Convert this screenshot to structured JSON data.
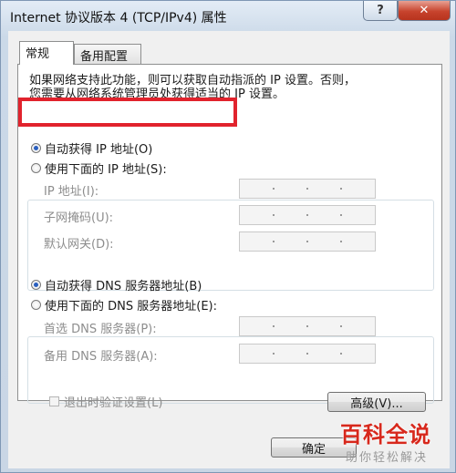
{
  "window": {
    "title": "Internet 协议版本 4 (TCP/IPv4) 属性",
    "help_label": "?",
    "close_label": "✕"
  },
  "tabs": [
    {
      "label": "常规",
      "selected": true
    },
    {
      "label": "备用配置",
      "selected": false
    }
  ],
  "general": {
    "description_line1": "如果网络支持此功能，则可以获取自动指派的 IP 设置。否则，",
    "description_line2": "您需要从网络系统管理员处获得适当的 IP 设置。",
    "ip_auto_label": "自动获得 IP 地址(O)",
    "ip_manual_label": "使用下面的 IP 地址(S):",
    "ip_fields": [
      {
        "label": "IP 地址(I):"
      },
      {
        "label": "子网掩码(U):"
      },
      {
        "label": "默认网关(D):"
      }
    ],
    "dns_auto_label": "自动获得 DNS 服务器地址(B)",
    "dns_manual_label": "使用下面的 DNS 服务器地址(E):",
    "dns_fields": [
      {
        "label": "首选 DNS 服务器(P):"
      },
      {
        "label": "备用 DNS 服务器(A):"
      }
    ],
    "validate_label": "退出时验证设置(L)",
    "advanced_label": "高级(V)..."
  },
  "footer": {
    "ok_label": "确定"
  },
  "watermark": {
    "main": "百科全说",
    "sub": "助你轻松解决"
  },
  "colors": {
    "highlight": "#e1232d",
    "close_button": "#c7432d",
    "radio_selected": "#2a5fbf"
  }
}
